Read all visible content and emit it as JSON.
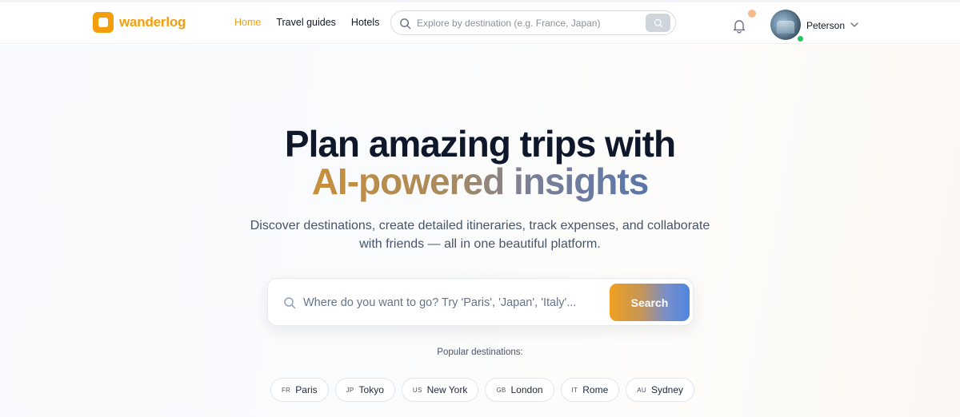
{
  "header": {
    "logo_text": "wanderlog",
    "nav": [
      {
        "label": "Home",
        "active": true
      },
      {
        "label": "Travel guides",
        "active": false
      },
      {
        "label": "Hotels",
        "active": false
      }
    ],
    "search_placeholder": "Explore by destination (e.g. France, Japan)",
    "user_name": "Peterson"
  },
  "hero": {
    "title_line1": "Plan amazing trips with",
    "title_line2": "AI-powered insights",
    "subtitle_line1": "Discover destinations, create detailed itineraries, track expenses, and collaborate",
    "subtitle_line2": "with friends — all in one beautiful platform.",
    "search_placeholder": "Where do you want to go? Try 'Paris', 'Japan', 'Italy'...",
    "search_button": "Search",
    "popular_label": "Popular destinations:",
    "destinations": [
      {
        "code": "FR",
        "name": "Paris"
      },
      {
        "code": "JP",
        "name": "Tokyo"
      },
      {
        "code": "US",
        "name": "New York"
      },
      {
        "code": "GB",
        "name": "London"
      },
      {
        "code": "IT",
        "name": "Rome"
      },
      {
        "code": "AU",
        "name": "Sydney"
      }
    ]
  },
  "colors": {
    "accent": "#f59e0b",
    "heading": "#0f172a",
    "online": "#22c55e",
    "notification": "#f6b98c"
  }
}
